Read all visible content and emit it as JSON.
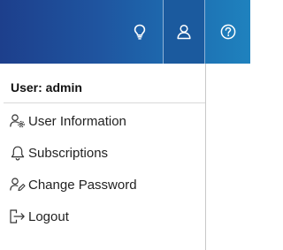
{
  "header": {
    "icons": [
      "lightbulb-icon",
      "user-icon",
      "help-icon"
    ],
    "colors": {
      "bar_start": "#1d3f8c",
      "bar_end": "#1f82be",
      "active_tab": "#1b5a9e"
    }
  },
  "user_menu": {
    "header": "User: admin",
    "items": [
      {
        "label": "User Information",
        "icon": "user-settings-icon"
      },
      {
        "label": "Subscriptions",
        "icon": "bell-icon"
      },
      {
        "label": "Change Password",
        "icon": "user-edit-icon"
      },
      {
        "label": "Logout",
        "icon": "logout-icon"
      }
    ]
  }
}
